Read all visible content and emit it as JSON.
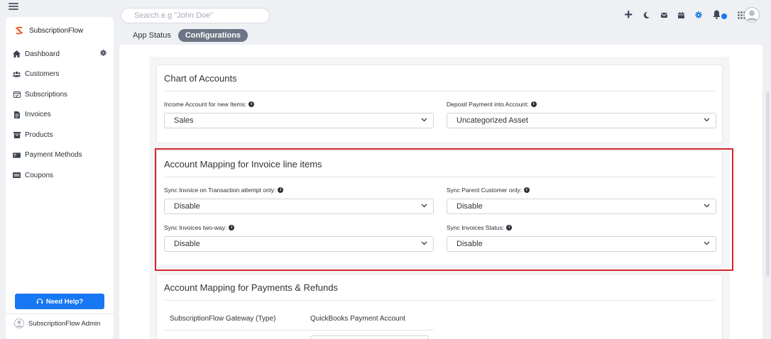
{
  "topbar": {
    "search_placeholder": "Search e.g \"John Doe\"",
    "icons": [
      "plus-icon",
      "moon-icon",
      "mail-icon",
      "calendar-icon",
      "gear-icon",
      "bell-icon",
      "apps-grid-icon",
      "user-avatar"
    ]
  },
  "sidebar": {
    "brand": "SubscriptionFlow",
    "items": [
      {
        "label": "Dashboard",
        "icon": "home-icon"
      },
      {
        "label": "Customers",
        "icon": "users-icon"
      },
      {
        "label": "Subscriptions",
        "icon": "calendar-check-icon"
      },
      {
        "label": "Invoices",
        "icon": "invoice-icon"
      },
      {
        "label": "Products",
        "icon": "products-icon"
      },
      {
        "label": "Payment Methods",
        "icon": "payment-card-icon"
      },
      {
        "label": "Coupons",
        "icon": "coupon-icon"
      }
    ],
    "help_label": "Need Help?",
    "user_name": "SubscriptionFlow Admin"
  },
  "tabs": [
    {
      "label": "App Status",
      "active": false
    },
    {
      "label": "Configurations",
      "active": true
    }
  ],
  "chart_of_accounts": {
    "title": "Chart of Accounts",
    "income_label": "Income Account for new Items:",
    "income_value": "Sales",
    "deposit_label": "Deposit Payment into Account:",
    "deposit_value": "Uncategorized Asset"
  },
  "invoice_mapping": {
    "title": "Account Mapping for Invoice line items",
    "sync_txn_label": "Sync Invoice on Transaction attempt only:",
    "sync_txn_value": "Disable",
    "sync_parent_label": "Sync Parent Customer only:",
    "sync_parent_value": "Disable",
    "sync_twoway_label": "Sync Invoices two-way:",
    "sync_twoway_value": "Disable",
    "sync_status_label": "Sync Invoices Status:",
    "sync_status_value": "Disable"
  },
  "payment_mapping": {
    "title": "Account Mapping for Payments & Refunds",
    "col_gateway": "SubscriptionFlow Gateway (Type)",
    "col_account": "QuickBooks Payment Account"
  },
  "colors": {
    "accent": "#1877f2",
    "highlight": "#d6262c",
    "active_tab": "#6c7685"
  }
}
